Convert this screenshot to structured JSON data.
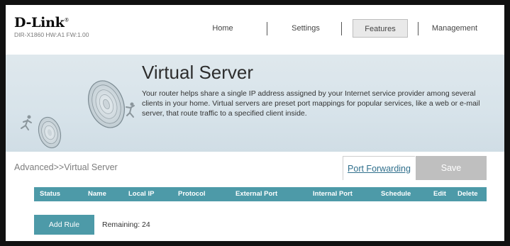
{
  "brand": {
    "logo_text": "D-Link",
    "model_info": "DIR-X1860 HW:A1 FW:1.00"
  },
  "nav": {
    "items": [
      {
        "label": "Home",
        "active": false
      },
      {
        "label": "Settings",
        "active": false
      },
      {
        "label": "Features",
        "active": true
      },
      {
        "label": "Management",
        "active": false
      }
    ]
  },
  "banner": {
    "title": "Virtual Server",
    "description": "Your router helps share a single IP address assigned by your Internet service provider among several clients in your home. Virtual servers are preset port mappings for popular services, like a web or e-mail server, that route traffic to a specified client inside."
  },
  "breadcrumb": "Advanced>>Virtual Server",
  "actions": {
    "port_forwarding_label": "Port Forwarding",
    "save_label": "Save"
  },
  "table": {
    "columns": [
      "Status",
      "Name",
      "Local IP",
      "Protocol",
      "External Port",
      "Internal Port",
      "Schedule",
      "Edit",
      "Delete"
    ]
  },
  "footer": {
    "add_rule_label": "Add Rule",
    "remaining_text": "Remaining: 24"
  },
  "colors": {
    "accent": "#4d9aa8",
    "save_disabled": "#bfbfbf",
    "link": "#2f6f8c"
  }
}
